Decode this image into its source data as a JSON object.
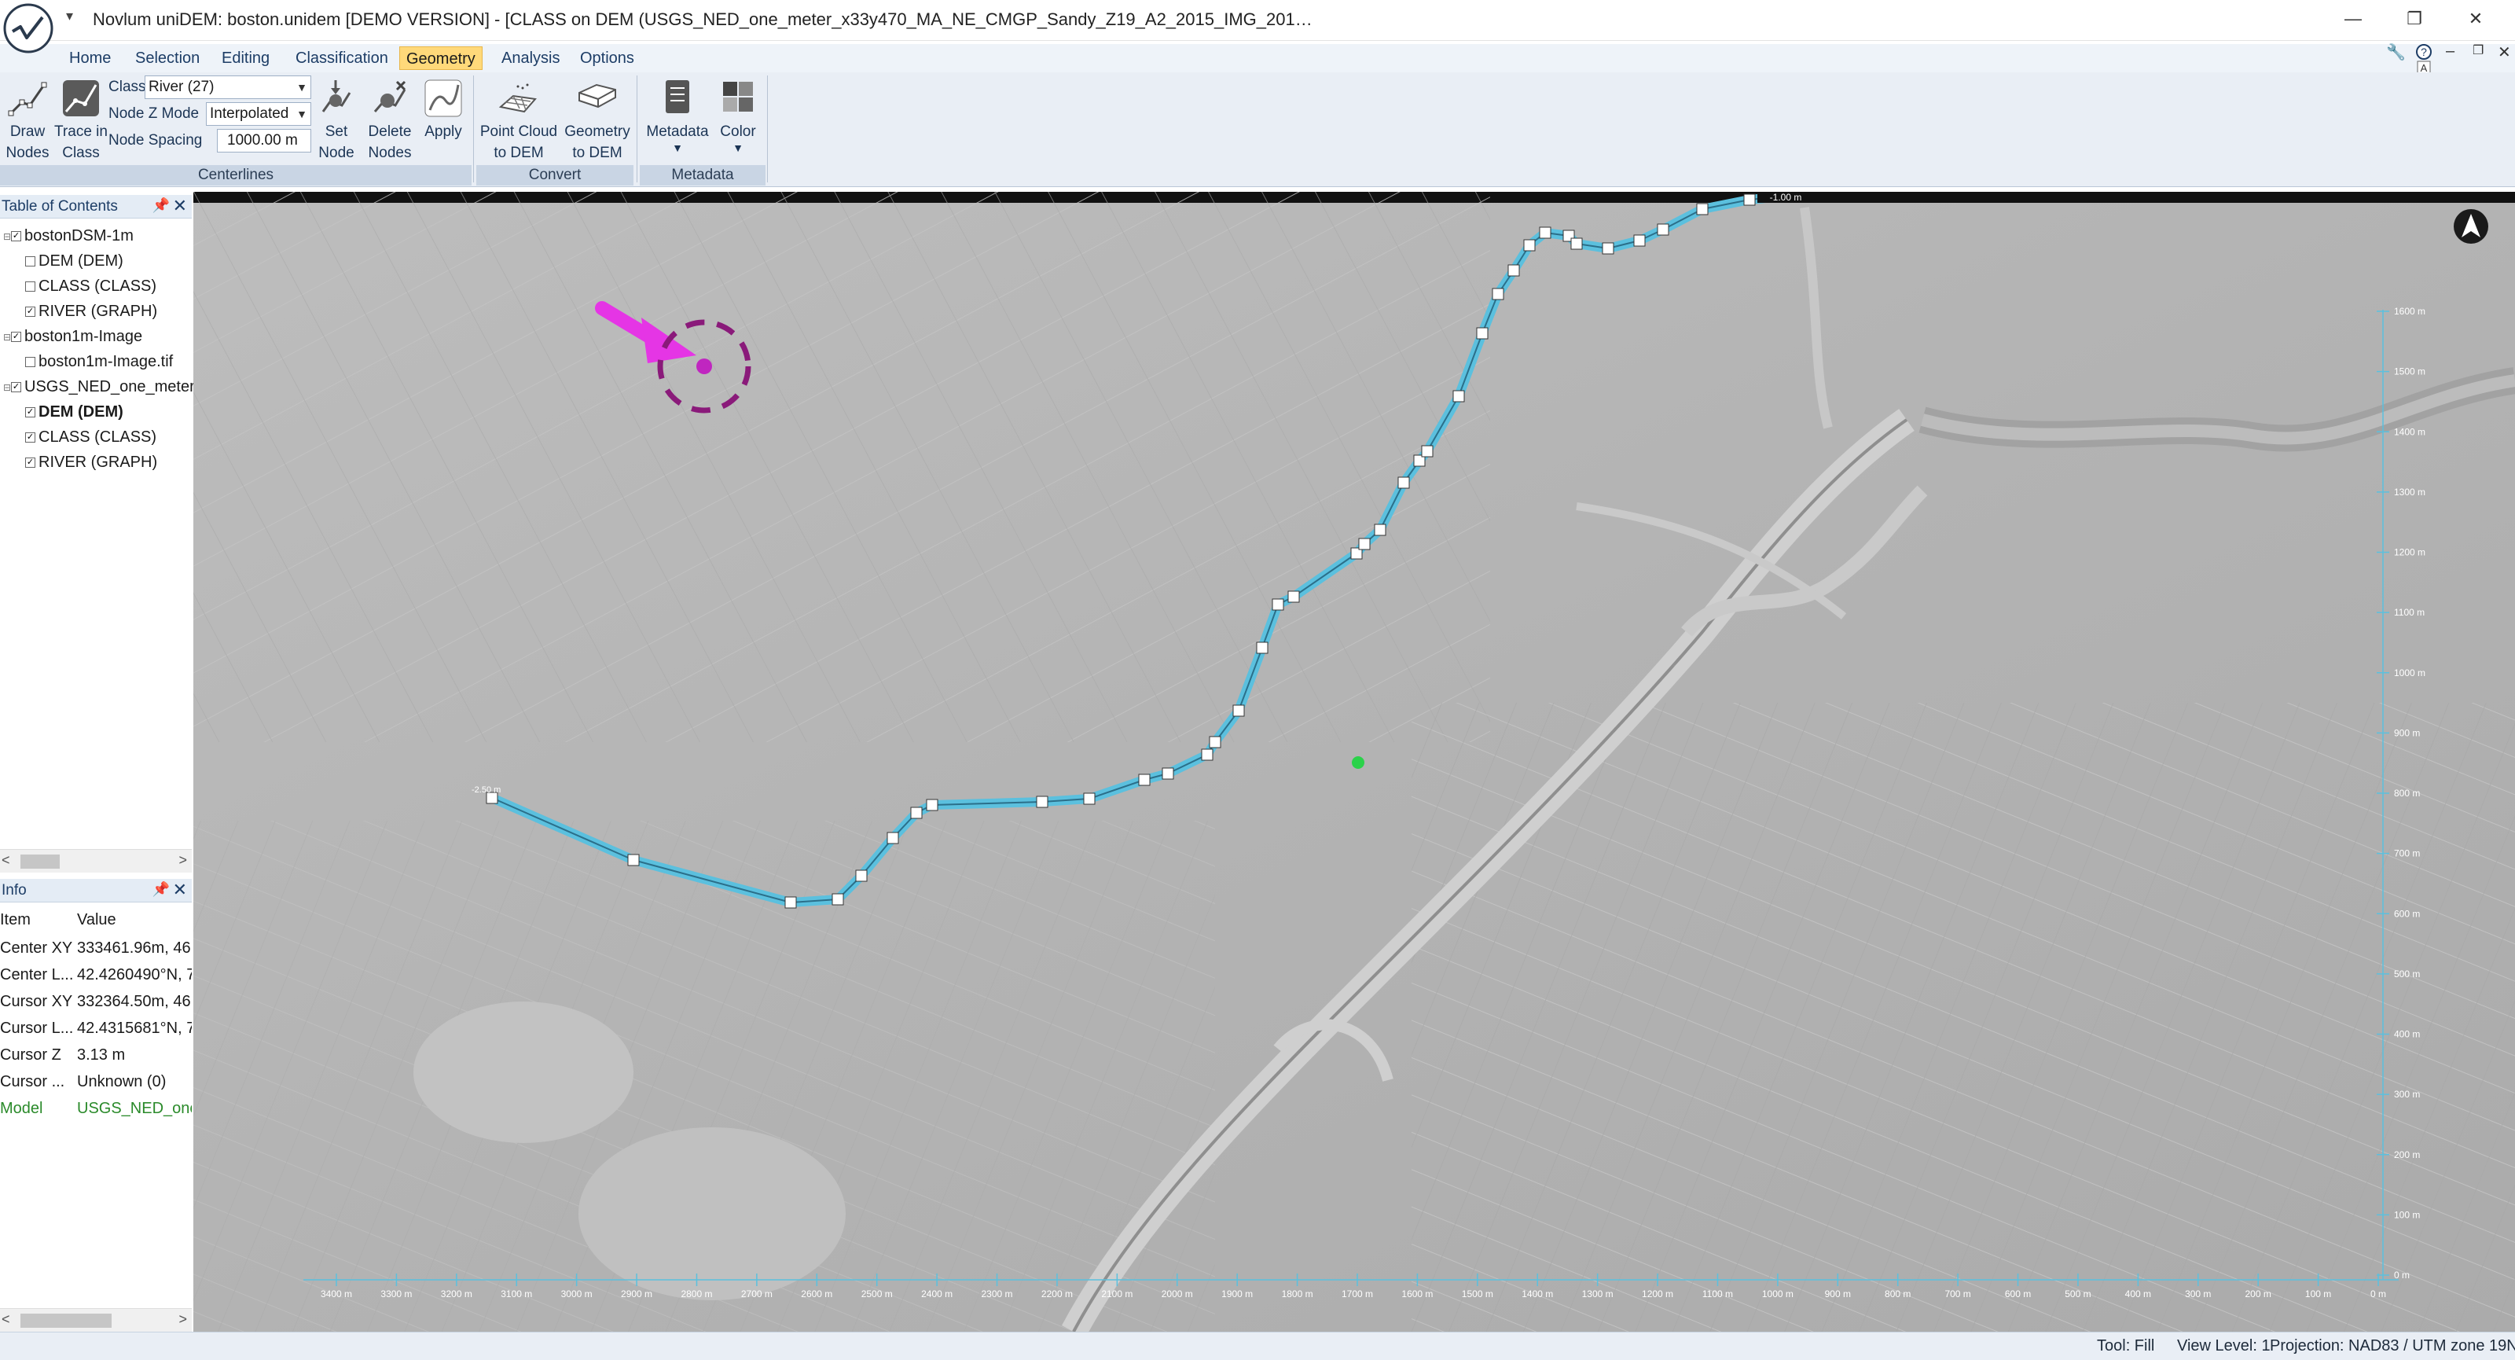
{
  "window": {
    "title": "Novlum uniDEM: boston.unidem [DEMO VERSION] - [CLASS on DEM (USGS_NED_one_meter_x33y470_MA_NE_CMGP_Sandy_Z19_A2_2015_IMG_201…",
    "minimize": "—",
    "restore": "❐",
    "close": "✕"
  },
  "menu": {
    "tabs": [
      "Home",
      "Selection",
      "Editing",
      "Classification",
      "Geometry",
      "Analysis",
      "Options"
    ],
    "active_tab": "Geometry"
  },
  "ribbon": {
    "centerlines": {
      "label": "Centerlines",
      "draw_nodes": "Draw Nodes",
      "trace_in_class": "Trace in Class",
      "class_label": "Class",
      "class_value": "River (27)",
      "node_z_mode_label": "Node Z Mode",
      "node_z_mode_value": "Interpolated",
      "node_spacing_label": "Node Spacing",
      "node_spacing_value": "1000.00 m",
      "set_node_z": "Set Node Z",
      "delete_nodes": "Delete Nodes",
      "apply": "Apply"
    },
    "convert": {
      "label": "Convert",
      "point_cloud_to_dem": "Point Cloud to DEM",
      "geometry_to_dem": "Geometry to DEM"
    },
    "metadata": {
      "label": "Metadata",
      "metadata_btn": "Metadata",
      "color_btn": "Color"
    }
  },
  "toc": {
    "title": "Table of Contents",
    "items": [
      {
        "label": "bostonDSM-1m",
        "checked": true,
        "level": 0
      },
      {
        "label": "DEM (DEM)",
        "checked": false,
        "level": 1
      },
      {
        "label": "CLASS (CLASS)",
        "checked": false,
        "level": 1
      },
      {
        "label": "RIVER (GRAPH)",
        "checked": true,
        "level": 1
      },
      {
        "label": "boston1m-Image",
        "checked": true,
        "level": 0
      },
      {
        "label": "boston1m-Image.tif",
        "checked": false,
        "level": 1
      },
      {
        "label": "USGS_NED_one_meter",
        "checked": true,
        "level": 0
      },
      {
        "label": "DEM (DEM)",
        "checked": true,
        "level": 1,
        "bold": true
      },
      {
        "label": "CLASS (CLASS)",
        "checked": true,
        "level": 1
      },
      {
        "label": "RIVER (GRAPH)",
        "checked": true,
        "level": 1
      }
    ]
  },
  "info": {
    "title": "Info",
    "col_item": "Item",
    "col_value": "Value",
    "rows": [
      {
        "k": "Center XY",
        "v": "333461.96m, 46"
      },
      {
        "k": "Center L...",
        "v": "42.4260490°N, 7"
      },
      {
        "k": "Cursor XY",
        "v": "332364.50m, 46"
      },
      {
        "k": "Cursor L...",
        "v": "42.4315681°N, 7"
      },
      {
        "k": "Cursor Z",
        "v": "3.13 m"
      },
      {
        "k": "Cursor ...",
        "v": "Unknown (0)"
      },
      {
        "k": "Model",
        "v": "USGS_NED_one",
        "color": "#2a8a2a"
      }
    ]
  },
  "map": {
    "top_scale_label": "-1.00 m",
    "start_node_label": "-2.50 m",
    "bottom_scale": [
      "3400 m",
      "3300 m",
      "3200 m",
      "3100 m",
      "3000 m",
      "2900 m",
      "2800 m",
      "2700 m",
      "2600 m",
      "2500 m",
      "2400 m",
      "2300 m",
      "2200 m",
      "2100 m",
      "2000 m",
      "1900 m",
      "1800 m",
      "1700 m",
      "1600 m",
      "1500 m",
      "1400 m",
      "1300 m",
      "1200 m",
      "1100 m",
      "1000 m",
      "900 m",
      "800 m",
      "700 m",
      "600 m",
      "500 m",
      "400 m",
      "300 m",
      "200 m",
      "100 m",
      "0 m"
    ],
    "right_scale": [
      "1600 m",
      "1500 m",
      "1400 m",
      "1300 m",
      "1200 m",
      "1100 m",
      "1000 m",
      "900 m",
      "800 m",
      "700 m",
      "600 m",
      "500 m",
      "400 m",
      "300 m",
      "200 m",
      "100 m",
      "0 m"
    ],
    "river_color": "#5bc0de",
    "cursor_color": "#e535e5",
    "north_arrow": "north-arrow-icon"
  },
  "status": {
    "tool": "Tool: Fill",
    "view_level": "View Level: 1",
    "projection": "Projection: NAD83 / UTM zone 19N"
  }
}
